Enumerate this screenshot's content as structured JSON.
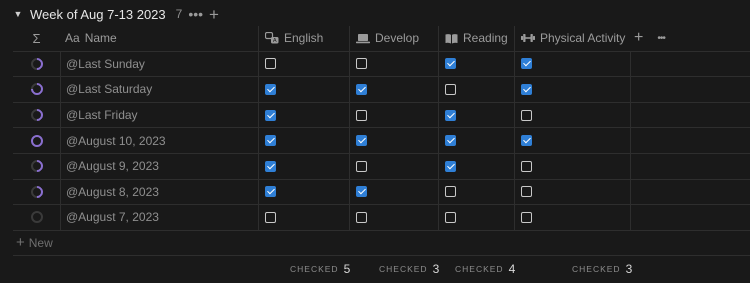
{
  "group": {
    "toggle_icon": "triangle-down-icon",
    "title": "Week of Aug 7-13 2023",
    "count": "7",
    "more_icon": "ellipsis-icon",
    "add_icon": "plus-icon"
  },
  "header": {
    "sigma": "Σ",
    "name": {
      "icon_text": "Aa",
      "label": "Name"
    },
    "english": {
      "icon": "translate-icon",
      "label": "English"
    },
    "develop": {
      "icon": "laptop-icon",
      "label": "Develop"
    },
    "reading": {
      "icon": "book-icon",
      "label": "Reading"
    },
    "physical": {
      "icon": "dumbbell-icon",
      "label": "Physical Activity"
    },
    "add_property": "+",
    "more": "•••"
  },
  "rows": [
    {
      "name": "@Last Sunday",
      "progress": 0.5,
      "english": false,
      "develop": false,
      "reading": true,
      "physical": true
    },
    {
      "name": "@Last Saturday",
      "progress": 0.75,
      "english": true,
      "develop": true,
      "reading": false,
      "physical": true
    },
    {
      "name": "@Last Friday",
      "progress": 0.5,
      "english": true,
      "develop": false,
      "reading": true,
      "physical": false
    },
    {
      "name": "@August 10, 2023",
      "progress": 1.0,
      "english": true,
      "develop": true,
      "reading": true,
      "physical": true
    },
    {
      "name": "@August 9, 2023",
      "progress": 0.5,
      "english": true,
      "develop": false,
      "reading": true,
      "physical": false
    },
    {
      "name": "@August 8, 2023",
      "progress": 0.5,
      "english": true,
      "develop": true,
      "reading": false,
      "physical": false
    },
    {
      "name": "@August 7, 2023",
      "progress": 0,
      "english": false,
      "develop": false,
      "reading": false,
      "physical": false
    }
  ],
  "new_row": {
    "icon": "+",
    "label": "New"
  },
  "calculations": {
    "english": {
      "label": "CHECKED",
      "value": "5"
    },
    "develop": {
      "label": "CHECKED",
      "value": "3"
    },
    "reading": {
      "label": "CHECKED",
      "value": "4"
    },
    "physical": {
      "label": "CHECKED",
      "value": "3"
    }
  },
  "colors": {
    "accent": "#2f7fd6",
    "progress_ring": "#8a6fcf",
    "background": "#191919"
  }
}
